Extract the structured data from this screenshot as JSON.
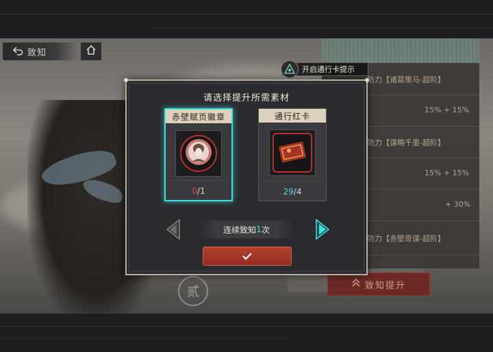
{
  "top_bar": {
    "back_label": "致知"
  },
  "pass_hint": {
    "label": "开启通行卡提示"
  },
  "modal": {
    "title": "请选择提升所需素材",
    "items": [
      {
        "name": "赤壁赋页徽章",
        "owned": "0",
        "required": "1",
        "selected": true
      },
      {
        "name": "通行红卡",
        "owned": "29",
        "required": "4",
        "selected": false
      }
    ],
    "count_prefix": "连续致知",
    "count_value": "1",
    "count_suffix": "次",
    "confirm_icon": "checkmark-icon"
  },
  "background": {
    "upgrade_button": "致知提升",
    "seal_char": "贰",
    "rows": [
      {
        "text": "防力【诸葛策马-超阶】"
      },
      {
        "text": "15%  +  15%"
      },
      {
        "text": "防力【谋略千里-超阶】"
      },
      {
        "text": "15%  +  15%"
      },
      {
        "text": "+  30%"
      },
      {
        "text": "防力【赤壁奇谋-超阶】"
      }
    ]
  },
  "colors": {
    "accent_cyan": "#3fe0df",
    "confirm_red": "#a3352a",
    "card_header": "#ddd2bd"
  }
}
